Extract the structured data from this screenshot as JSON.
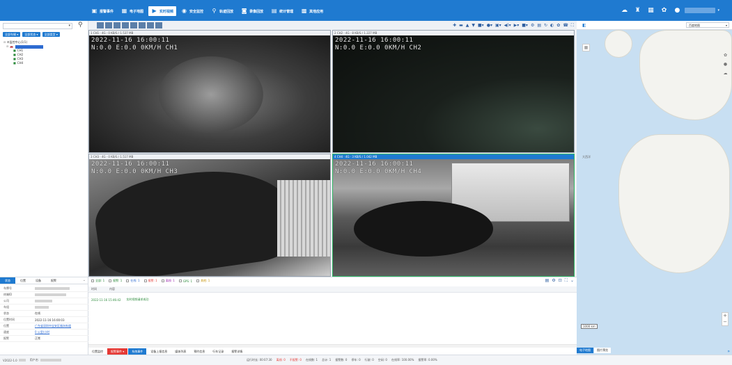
{
  "topnav": [
    {
      "label": "报警事件",
      "icon": "▣"
    },
    {
      "label": "电子地图",
      "icon": "▦"
    },
    {
      "label": "实时视频",
      "icon": "▶",
      "active": true
    },
    {
      "label": "安全监控",
      "icon": "◉"
    },
    {
      "label": "轨迹回放",
      "icon": "⚲"
    },
    {
      "label": "录像回放",
      "icon": "◙"
    },
    {
      "label": "统计管理",
      "icon": "▤"
    },
    {
      "label": "其他应用",
      "icon": "▩"
    }
  ],
  "topright": {
    "icons": [
      "cloud-icon",
      "shirt-icon",
      "grid-icon",
      "settings-icon",
      "user-icon"
    ],
    "caret": "▾"
  },
  "left": {
    "search": {
      "value": "",
      "dropdown": "▾"
    },
    "filters": [
      "全部车辆 ▾",
      "全部状态 ▾",
      "全部类型 ▾"
    ],
    "tree": {
      "root": "监控中心(1/1)",
      "channels": [
        "CH1",
        "CH2",
        "CH3",
        "CH4"
      ]
    }
  },
  "video": {
    "tiles": [
      {
        "title": "1  CH1 · 4G · 0 KB/S / 1.537 MB",
        "osd": "2022-11-16 16:00:11\nN:0.0 E:0.0 0KM/H CH1"
      },
      {
        "title": "2  CH2 · 4G · 8 KB/S / 1.227 MB",
        "osd": "2022-11-16 16:00:11\nN:0.0 E:0.0 0KM/H CH2"
      },
      {
        "title": "3  CH3 · 4G · 0 KB/S / 1.517 MB",
        "osd": "2022-11-16 16:00:11\nN:0.0 E:0.0 0KM/H CH3"
      },
      {
        "title": "4  CH4 · 4G · 3 KB/S / 1.042 MB",
        "osd": "2022-11-16 16:00:11\nN:0.0 E:0.0 0KM/H CH4"
      }
    ]
  },
  "map": {
    "select": "百度地图",
    "labels": [
      "大西洋"
    ],
    "scale": "1000 km",
    "tabs": [
      "电子地图",
      "图片预览"
    ],
    "zoom_in": "+",
    "zoom_out": "−"
  },
  "info": {
    "tabs": [
      "状态",
      "位置",
      "设备",
      "报警"
    ],
    "rows": [
      {
        "k": "车牌号",
        "v": ""
      },
      {
        "k": "终端ID",
        "v": ""
      },
      {
        "k": "公司",
        "v": ""
      },
      {
        "k": "车组",
        "v": ""
      },
      {
        "k": "状态",
        "v": "在线"
      },
      {
        "k": "位置时间",
        "v": "2022-11-16 16:00:03"
      },
      {
        "k": "位置",
        "v": "广东省深圳市宝安区福永街道"
      },
      {
        "k": "速度",
        "v": "0 公里/小时"
      },
      {
        "k": "报警",
        "v": "正常"
      }
    ]
  },
  "alarm": {
    "filters": [
      "全部: 1",
      "报警: 1",
      "在线: 1",
      "报警: 1",
      "离线: 1",
      "GPS: 1",
      "其他: 1"
    ],
    "headers": [
      "时间",
      "内容"
    ],
    "rows": [
      {
        "time": "2022-11-16 15:46:42",
        "content": "实时视频请求成功"
      }
    ],
    "tabs": [
      "位置监控",
      "报警事件 ▾",
      "系统事件",
      "设备上报信息",
      "媒体列表",
      "预约信息",
      "行车记录",
      "报警详情"
    ]
  },
  "status": {
    "left": [
      "V2022-1.0",
      "用户名:"
    ],
    "right": [
      "运行时长: 00:07:30",
      "离线: 0",
      "不报警: 0",
      "在线数: 1",
      "总计: 1",
      "报警数: 0",
      "停车: 0",
      "行驶: 0",
      "空闲: 0",
      "在线率: 100.00%",
      "报警率: 0.00%"
    ]
  }
}
